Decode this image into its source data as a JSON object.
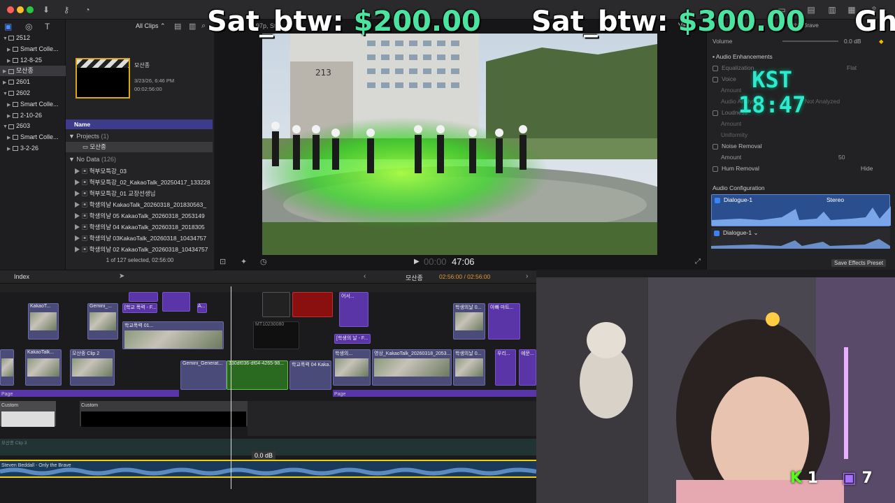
{
  "overlay": {
    "sat1_label": "Sat_btw:",
    "sat1_value": "$200.00",
    "sat2_label": "Sat_btw:",
    "sat2_value": "$300.00",
    "sat3_partial": "Gh",
    "kst_label": "KST",
    "kst_time": "18:47",
    "kick_count": "1",
    "twitch_count": "7"
  },
  "library": {
    "items": [
      {
        "label": "2512",
        "level": 0,
        "tri": "▼"
      },
      {
        "label": "Smart Colle...",
        "level": 1,
        "tri": "▶"
      },
      {
        "label": "12-8-25",
        "level": 1,
        "tri": "▶"
      },
      {
        "label": "모산종",
        "level": 0,
        "tri": "▶"
      },
      {
        "label": "2601",
        "level": 0,
        "tri": "▶"
      },
      {
        "label": "2602",
        "level": 0,
        "tri": "▼"
      },
      {
        "label": "Smart Colle...",
        "level": 1,
        "tri": "▶"
      },
      {
        "label": "2-10-26",
        "level": 1,
        "tri": "▶"
      },
      {
        "label": "2603",
        "level": 0,
        "tri": "▼"
      },
      {
        "label": "Smart Colle...",
        "level": 1,
        "tri": "▶"
      },
      {
        "label": "3-2-26",
        "level": 1,
        "tri": "▶"
      }
    ]
  },
  "browser": {
    "filter_label": "All Clips",
    "clip_title": "모산종",
    "clip_date": "3/23/26, 6:46 PM",
    "clip_duration": "00:02:56:00",
    "column_name": "Name",
    "projects_label": "Projects",
    "projects_count": "(1)",
    "project_item": "모산종",
    "nodata_label": "No Data",
    "nodata_count": "(126)",
    "rows": [
      "혁부모특강_03",
      "혁부모특강_02_KakaoTalk_20250417_133228",
      "혁부모특강_01 교장선생님",
      "학생의날 KakaoTalk_20260318_201830563_",
      "학생의날 05 KakaoTalk_20260318_2053149",
      "학생의날 04 KakaoTalk_20260318_2018305",
      "학생의날 03KakaoTalk_20260318_10434757",
      "학생의날 02 KakaoTalk_20260318_10434757"
    ],
    "status": "1 of 127 selected, 02:56:00"
  },
  "viewer": {
    "top_text": "97p, Ste",
    "view_label": "View",
    "building_number": "213",
    "timecode_dim": "00:00",
    "timecode": "47:06"
  },
  "inspector": {
    "volume_label": "Volume",
    "volume_value": "0.0 dB",
    "audio_enh": "Audio Enhancements",
    "equalization": "Equalization",
    "eq_value": "Flat",
    "voice": "Voice",
    "amount": "Amount",
    "audio_analysis": "Audio Analysis",
    "not_analyzed": "Not Analyzed",
    "loudness": "Loudness",
    "uniformity": "Uniformity",
    "noise_removal": "Noise Removal",
    "amount_val": "50",
    "hum_removal": "Hum Removal",
    "hide": "Hide",
    "audio_config": "Audio Configuration",
    "dialogue1": "Dialogue-1",
    "stereo": "Stereo",
    "dialogue2": "Dialogue-1",
    "save_preset": "Save Effects Preset",
    "brave_text": "ly the Brave"
  },
  "timeline": {
    "index_label": "Index",
    "project_name": "모산종",
    "timecode": "02:56:00 / 02:56:00",
    "clip_kakao": "KakaoT...",
    "clip_gemini": "Gemini_...",
    "clip_school": "[학교 폭력 - F...",
    "clip_a": "A...",
    "clip_events": "어서...",
    "clip_school01": "학교폭력 01...",
    "clip_mt": "MT10230080",
    "clip_student_ev": "[학생의 날 - F...",
    "clip_student0": "학생의날 0...",
    "clip_other": "아빠 마트...",
    "clip_kakaotalk": "KakaoTalk...",
    "clip_mosan2": "모산종 Clip 2",
    "clip_gemini_gen": "Gemini_Generat...",
    "clip_hash": "330df036-df04-4265-98...",
    "clip_school04": "학교폭력 04 Kaka...",
    "clip_student_day": "학생의...",
    "clip_kakao_long": "영상_KakaoTalk_20260318_2053...",
    "clip_student_day2": "학생의날 0...",
    "clip_uri": "우리...",
    "clip_ext": "예문...",
    "page_label1": "Page",
    "page_label2": "Page",
    "custom1": "Custom",
    "custom2": "Custom",
    "clip3": "모산종 Clip 3",
    "music": "Steven Beddall - Only the Brave",
    "db_tooltip": "0.0 dB"
  }
}
